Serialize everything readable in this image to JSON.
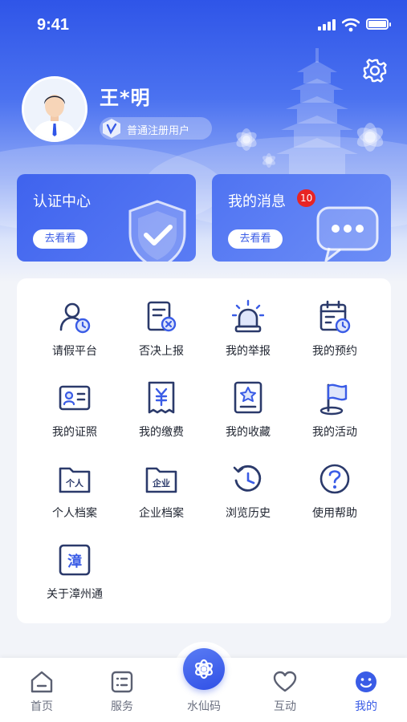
{
  "status_bar": {
    "time": "9:41"
  },
  "profile": {
    "name": "王*明",
    "badge_text": "普通注册用户"
  },
  "cards": {
    "auth": {
      "title": "认证中心",
      "button": "去看看"
    },
    "messages": {
      "title": "我的消息",
      "badge_count": "10",
      "button": "去看看"
    }
  },
  "services": [
    {
      "label": "请假平台",
      "icon": "person-clock-icon"
    },
    {
      "label": "否决上报",
      "icon": "document-reject-icon"
    },
    {
      "label": "我的举报",
      "icon": "alarm-light-icon"
    },
    {
      "label": "我的预约",
      "icon": "calendar-clock-icon"
    },
    {
      "label": "我的证照",
      "icon": "id-card-icon"
    },
    {
      "label": "我的缴费",
      "icon": "yuan-receipt-icon"
    },
    {
      "label": "我的收藏",
      "icon": "star-document-icon"
    },
    {
      "label": "我的活动",
      "icon": "flag-icon"
    },
    {
      "label": "个人档案",
      "icon": "personal-folder-icon",
      "icon_text": "个人"
    },
    {
      "label": "企业档案",
      "icon": "enterprise-folder-icon",
      "icon_text": "企业"
    },
    {
      "label": "浏览历史",
      "icon": "history-icon"
    },
    {
      "label": "使用帮助",
      "icon": "help-icon"
    },
    {
      "label": "关于漳州通",
      "icon": "app-logo-icon",
      "icon_text": "漳"
    }
  ],
  "tabbar": {
    "items": [
      {
        "label": "首页",
        "icon": "home-icon"
      },
      {
        "label": "服务",
        "icon": "service-list-icon"
      },
      {
        "label": "水仙码",
        "icon": "narcissus-icon"
      },
      {
        "label": "互动",
        "icon": "heart-icon"
      },
      {
        "label": "我的",
        "icon": "smiley-icon",
        "active": true
      }
    ]
  },
  "colors": {
    "primary": "#3a5ce6",
    "badge_red": "#e82424",
    "icon_navy": "#2b3a6b"
  }
}
